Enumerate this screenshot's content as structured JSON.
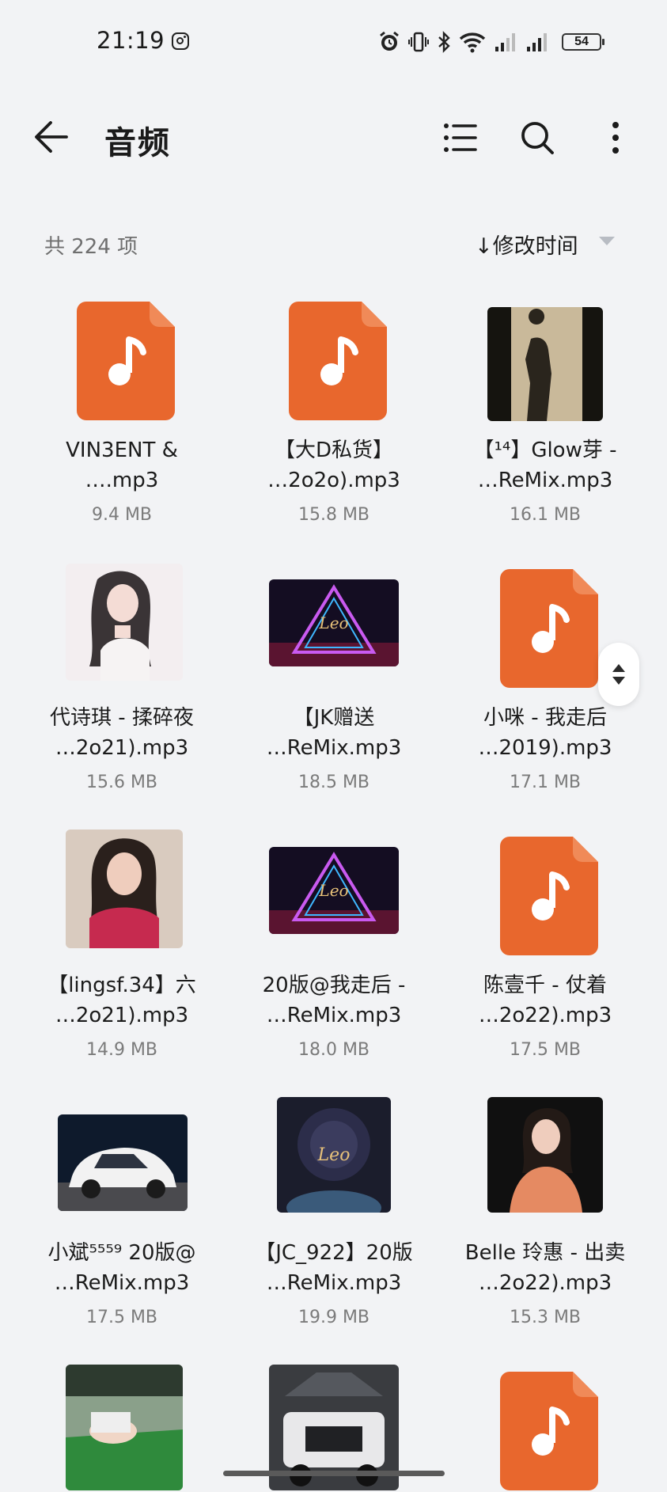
{
  "status_bar": {
    "time": "21:19",
    "battery": "54",
    "icons": [
      "instagram-icon",
      "alarm-icon",
      "vibrate-icon",
      "bluetooth-icon",
      "wifi-icon",
      "signal-icon",
      "signal-icon",
      "battery-icon"
    ]
  },
  "toolbar": {
    "title": "音频",
    "icons": [
      "back-arrow-icon",
      "list-view-icon",
      "search-icon",
      "more-vert-icon"
    ]
  },
  "summary": {
    "count": "共 224 项",
    "sort_label": "↓修改时间"
  },
  "colors": {
    "accent": "#e8672d",
    "background": "#f2f3f5"
  },
  "files": [
    {
      "line1": "VIN3ENT &",
      "line2": "….mp3",
      "size": "9.4 MB",
      "thumb": "music-file-icon"
    },
    {
      "line1": "【大D私货】",
      "line2": "…2o2o).mp3",
      "size": "15.8 MB",
      "thumb": "music-file-icon"
    },
    {
      "line1": "【¹⁴】Glow芽 -",
      "line2": "…ReMix.mp3",
      "size": "16.1 MB",
      "thumb": "silhouette-image"
    },
    {
      "line1": "代诗琪 - 揉碎夜",
      "line2": "…2o21).mp3",
      "size": "15.6 MB",
      "thumb": "illustration-image"
    },
    {
      "line1": "【JK赠送",
      "line2": "…ReMix.mp3",
      "size": "18.5 MB",
      "thumb": "neon-triangle-image"
    },
    {
      "line1": "小咪 - 我走后",
      "line2": "…2019).mp3",
      "size": "17.1 MB",
      "thumb": "music-file-icon"
    },
    {
      "line1": "【lingsf.34】六",
      "line2": "…2o21).mp3",
      "size": "14.9 MB",
      "thumb": "portrait-image"
    },
    {
      "line1": "20版@我走后 -",
      "line2": "…ReMix.mp3",
      "size": "18.0 MB",
      "thumb": "neon-triangle-image"
    },
    {
      "line1": "陈壹千 - 仗着",
      "line2": "…2o22).mp3",
      "size": "17.5 MB",
      "thumb": "music-file-icon"
    },
    {
      "line1": "小斌⁵⁵⁵⁹ 20版@",
      "line2": "…ReMix.mp3",
      "size": "17.5 MB",
      "thumb": "car-image"
    },
    {
      "line1": "【JC_922】20版",
      "line2": "…ReMix.mp3",
      "size": "19.9 MB",
      "thumb": "lion-image"
    },
    {
      "line1": "Belle 玲惠 - 出卖",
      "line2": "…2o22).mp3",
      "size": "15.3 MB",
      "thumb": "portrait-image"
    },
    {
      "line1": "",
      "line2": "",
      "size": "",
      "thumb": "billiards-image"
    },
    {
      "line1": "",
      "line2": "",
      "size": "",
      "thumb": "truck-image"
    },
    {
      "line1": "",
      "line2": "",
      "size": "",
      "thumb": "music-file-icon"
    }
  ]
}
